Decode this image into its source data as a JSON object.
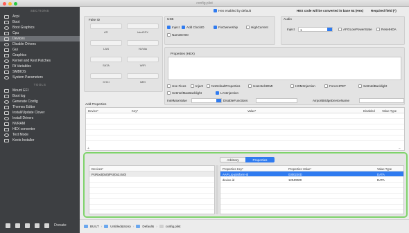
{
  "window": {
    "title": "config.plist"
  },
  "sidebar": {
    "section_sections": "SECTIONS",
    "sections": [
      {
        "label": "Acpi",
        "icon": "acpi-icon"
      },
      {
        "label": "Boot",
        "icon": "boot-icon"
      },
      {
        "label": "Boot Graphics",
        "icon": "boot-graphics-icon"
      },
      {
        "label": "Cpu",
        "icon": "cpu-icon"
      },
      {
        "label": "Devices",
        "icon": "devices-icon",
        "selected": true
      },
      {
        "label": "Disable Drivers",
        "icon": "disable-drivers-icon"
      },
      {
        "label": "Gui",
        "icon": "gui-icon"
      },
      {
        "label": "Graphics",
        "icon": "graphics-icon"
      },
      {
        "label": "Kernel and Kext Patches",
        "icon": "kernel-icon"
      },
      {
        "label": "Rt Variables",
        "icon": "rt-variables-icon"
      },
      {
        "label": "SMBIOS",
        "icon": "smbios-icon"
      },
      {
        "label": "System Parameters",
        "icon": "system-parameters-icon"
      }
    ],
    "section_tools": "TOOLS",
    "tools": [
      {
        "label": "Mount EFI",
        "icon": "mount-efi-icon"
      },
      {
        "label": "Boot log",
        "icon": "boot-log-icon"
      },
      {
        "label": "Generate Config",
        "icon": "generate-config-icon"
      },
      {
        "label": "Themes Editor",
        "icon": "themes-editor-icon"
      },
      {
        "label": "Install/Update Clover",
        "icon": "install-clover-icon"
      },
      {
        "label": "Install Drivers",
        "icon": "install-drivers-icon"
      },
      {
        "label": "NVRAM",
        "icon": "nvram-icon"
      },
      {
        "label": "HEX converter",
        "icon": "hex-converter-icon"
      },
      {
        "label": "Text Mode",
        "icon": "text-mode-icon"
      },
      {
        "label": "Kexts Installer",
        "icon": "kexts-installer-icon"
      }
    ],
    "donate_label": "Donate"
  },
  "topbar": {
    "hex_default_label": "Hex enabled by default",
    "hex_note": "HEX code will be converted in base 64 (Hex)",
    "required_note": "Required field (*)"
  },
  "fake_id": {
    "title": "Fake ID",
    "buttons": [
      "ATI",
      "IntelGFX",
      "LAN",
      "NVidia",
      "SATA",
      "WIFI",
      "XHCI",
      "IMEI"
    ]
  },
  "usb": {
    "title": "USB",
    "options": [
      {
        "label": "Inject",
        "checked": true
      },
      {
        "label": "Add ClockID",
        "checked": true
      },
      {
        "label": "FixOwnership",
        "checked": true
      },
      {
        "label": "HighCurrent",
        "checked": false
      },
      {
        "label": "NameEH00",
        "checked": false
      }
    ]
  },
  "audio": {
    "title": "Audio",
    "inject_label": "Inject",
    "inject_value": "1",
    "options": [
      {
        "label": "AFGLowPowerState",
        "checked": false
      },
      {
        "label": "ResetHDA",
        "checked": false
      }
    ]
  },
  "properties_hex": {
    "title": "Properties (HEX)"
  },
  "flags": [
    {
      "label": "Use Fixes",
      "checked": false
    },
    {
      "label": "Inject",
      "checked": false
    },
    {
      "label": "NoDefaultProperties",
      "checked": false
    },
    {
      "label": "UseIntelHDMI",
      "checked": false
    },
    {
      "label": "HDMIInjection",
      "checked": false
    },
    {
      "label": "ForceHPET",
      "checked": false
    },
    {
      "label": "SetIntelBacklight",
      "checked": false
    },
    {
      "label": "SetIntelMaxBacklight",
      "checked": false
    },
    {
      "label": "LANInjection",
      "checked": true
    }
  ],
  "misc_fields": {
    "intel_max_value_label": "IntelMaxValue",
    "intel_max_value": "",
    "disable_functions_label": "DisableFunctions",
    "disable_functions_value": "",
    "airport_label": "AirportBridgeDeviceName",
    "airport_value": ""
  },
  "add_properties": {
    "title": "Add Properties",
    "columns": [
      "Device*",
      "Key*",
      "Value*",
      "Disabled",
      "Value Type"
    ]
  },
  "properties_panel": {
    "tabs": [
      {
        "label": "Arbitrary"
      },
      {
        "label": "Properties"
      }
    ],
    "left_header": "Devices*",
    "left_rows": [
      {
        "value": "PciRoot(0x0)/Pci(0x2,0x0)"
      }
    ],
    "right_columns": [
      "Properties Key*",
      "Properties Value*",
      "Value Type"
    ],
    "right_rows": [
      {
        "key": "AAPL,ig-platform-id",
        "value": "0300220D",
        "type": "DATA",
        "selected": true
      },
      {
        "key": "device-id",
        "value": "12040000",
        "type": "DATA",
        "selected": false
      }
    ]
  },
  "pathbar": {
    "segments": [
      "BUILT",
      "Untitled&Sorry",
      "Defaults",
      "config.plist"
    ]
  },
  "colors": {
    "accent": "#2f7bf0",
    "highlight_border": "#7ed36a",
    "sidebar_bg": "#3d3f42"
  }
}
